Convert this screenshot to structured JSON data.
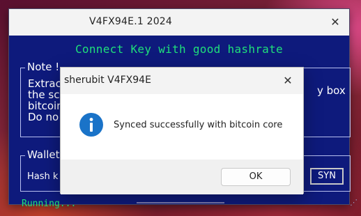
{
  "main_window": {
    "title": "V4FX94E.1 2024",
    "close_glyph": "✕",
    "headline": "Connect  Key with good hashrate",
    "note_group": {
      "label": "Note !",
      "visible_text": "Extrac\nthe sc\nbitcoin\nDo no",
      "right_fragment": "y box"
    },
    "wallet_group": {
      "label": "Wallet",
      "hash_label_fragment": "Hash k"
    },
    "syn_button_label": "SYN",
    "status": "Running...",
    "resize_grip_glyph": "⋰"
  },
  "dialog": {
    "title": "sherubit V4FX94E",
    "close_glyph": "✕",
    "icon": "info-icon",
    "message": "Synced successfully with bitcoin core",
    "ok_label": "OK"
  },
  "colors": {
    "window_bg": "#0e1a7c",
    "headline_green": "#1fe07a",
    "info_blue": "#1a73c8"
  }
}
